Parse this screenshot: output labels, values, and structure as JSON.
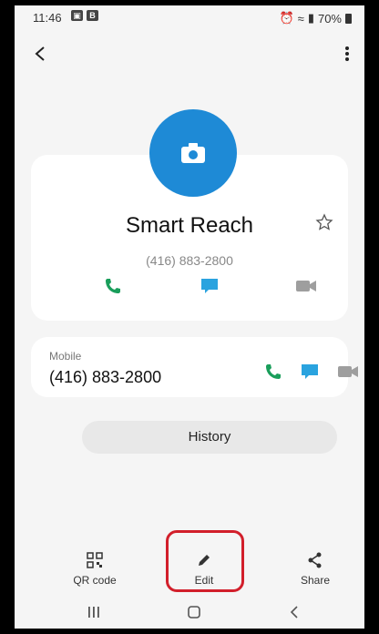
{
  "status_bar": {
    "time": "11:46",
    "notif_b": "B",
    "battery": "70%"
  },
  "contact": {
    "name": "Smart Reach",
    "number": "(416) 883-2800",
    "avatar_color": "#1e8ad6",
    "actions": [
      "phone-icon",
      "message-icon",
      "video-icon"
    ]
  },
  "mobile": {
    "label": "Mobile",
    "number": "(416) 883-2800"
  },
  "history": {
    "label": "History"
  },
  "toolbar": {
    "qr_label": "QR code",
    "edit_label": "Edit",
    "share_label": "Share"
  },
  "colors": {
    "call_green": "#1a9e5b",
    "message_blue": "#2aa3df",
    "video_gray": "#9e9e9e",
    "highlight_red": "#d21f2b"
  }
}
